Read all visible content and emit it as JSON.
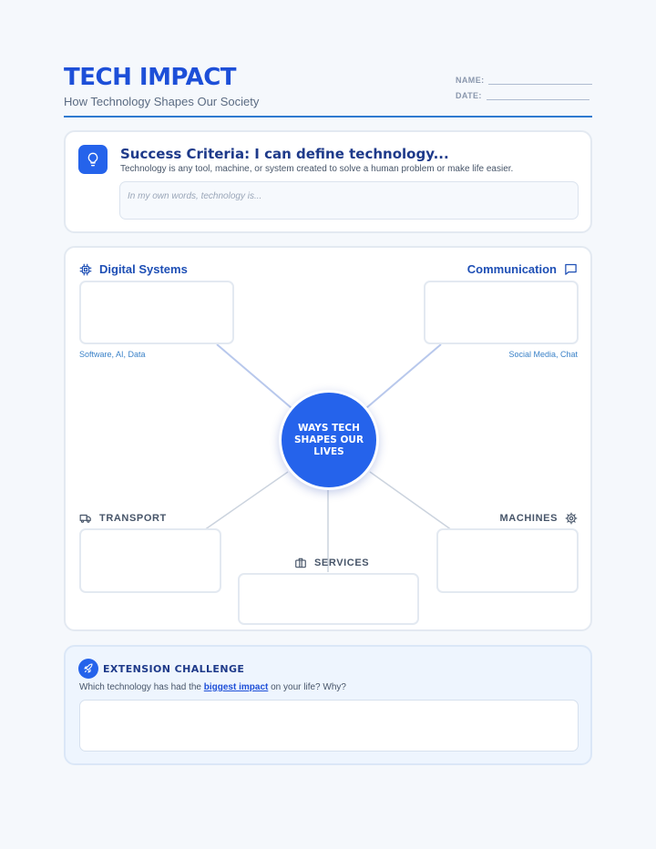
{
  "header": {
    "title": "TECH IMPACT",
    "subtitle": "How Technology Shapes Our Society",
    "name_label": "NAME:",
    "date_label": "DATE:"
  },
  "criteria": {
    "title": "Success Criteria: I can define technology...",
    "description": "Technology is any tool, machine, or system created to solve a human problem or make life easier.",
    "placeholder": "In my own words, technology is..."
  },
  "mindmap": {
    "center": "WAYS TECH SHAPES OUR LIVES",
    "digital": {
      "label": "Digital Systems",
      "hint": "Software, AI, Data"
    },
    "communication": {
      "label": "Communication",
      "hint": "Social Media, Chat"
    },
    "transport": {
      "label": "TRANSPORT"
    },
    "machines": {
      "label": "MACHINES"
    },
    "services": {
      "label": "SERVICES"
    }
  },
  "extension": {
    "title": "EXTENSION CHALLENGE",
    "question_before": "Which technology has had the ",
    "question_emphasis": "biggest impact",
    "question_after": " on your life? Why?"
  },
  "colors": {
    "accent": "#2563eb",
    "title": "#1d4fd8",
    "rule": "#2f7ad0"
  },
  "icons": {
    "criteria": "lightbulb-icon",
    "digital": "cpu-chip-icon",
    "communication": "chat-bubble-icon",
    "transport": "truck-icon",
    "machines": "gear-icon",
    "services": "briefcase-icon",
    "extension": "rocket-icon"
  }
}
